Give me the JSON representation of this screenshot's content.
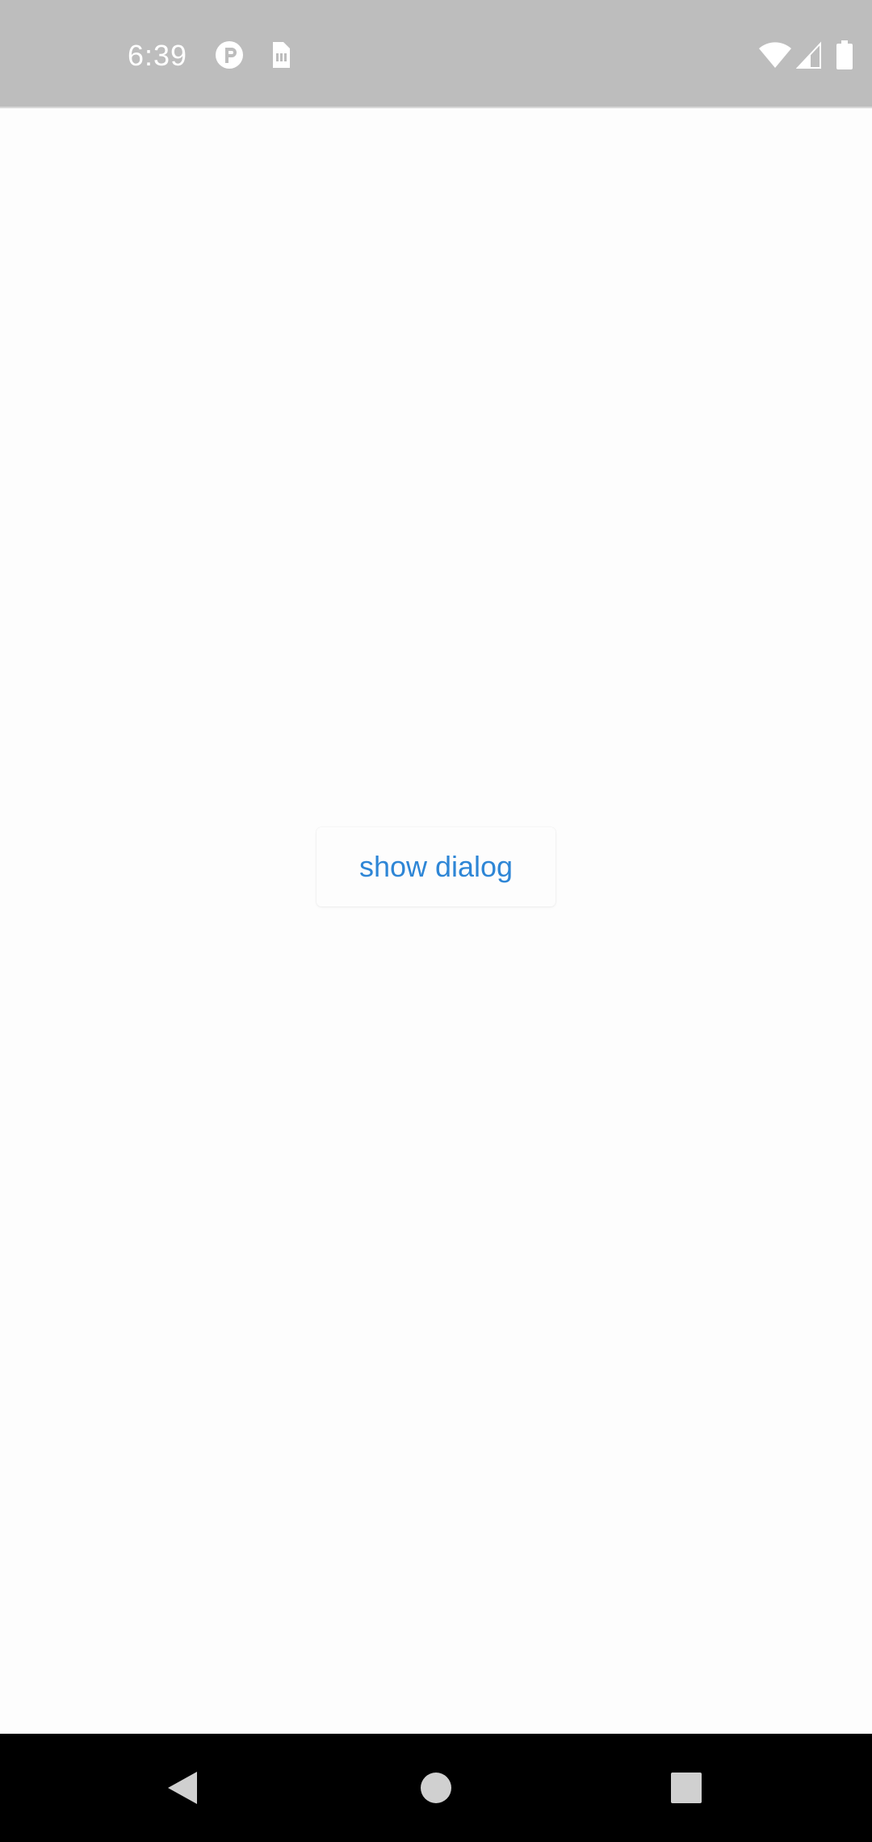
{
  "status_bar": {
    "time": "6:39",
    "background_color": "#bdbdbd",
    "icons": {
      "left": [
        "notification-p-icon",
        "sim-card-icon"
      ],
      "right": [
        "wifi-icon",
        "cellular-signal-icon",
        "battery-icon"
      ]
    }
  },
  "main": {
    "show_dialog_button": {
      "label": "show dialog",
      "text_color": "#2e86d6"
    }
  },
  "nav_bar": {
    "background_color": "#000000",
    "buttons": [
      "back-icon",
      "home-icon",
      "recents-icon"
    ]
  }
}
